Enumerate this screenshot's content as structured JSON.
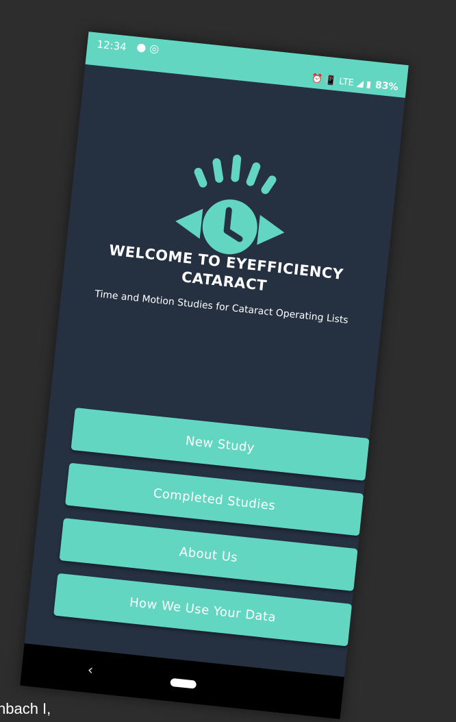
{
  "status_bar": {
    "time": "12:34",
    "notifications": "● ◎",
    "indicators": "⏰ 📳 LTE ◢ ▮",
    "battery": "83%"
  },
  "welcome": {
    "title": "WELCOME TO EYEFFICIENCY CATARACT",
    "subtitle": "Time and Motion Studies for Cataract Operating Lists"
  },
  "menu": {
    "new_study": "New Study",
    "completed_studies": "Completed Studies",
    "about_us": "About Us",
    "data_use": "How We Use Your Data"
  },
  "nav": {
    "back": "‹"
  },
  "caption": "hbach I,",
  "colors": {
    "accent": "#63d6c2",
    "background": "#253041",
    "outer": "#2e2d2e"
  },
  "icons": [
    "eye-clock-logo-icon",
    "back-icon",
    "home-pill-icon"
  ]
}
